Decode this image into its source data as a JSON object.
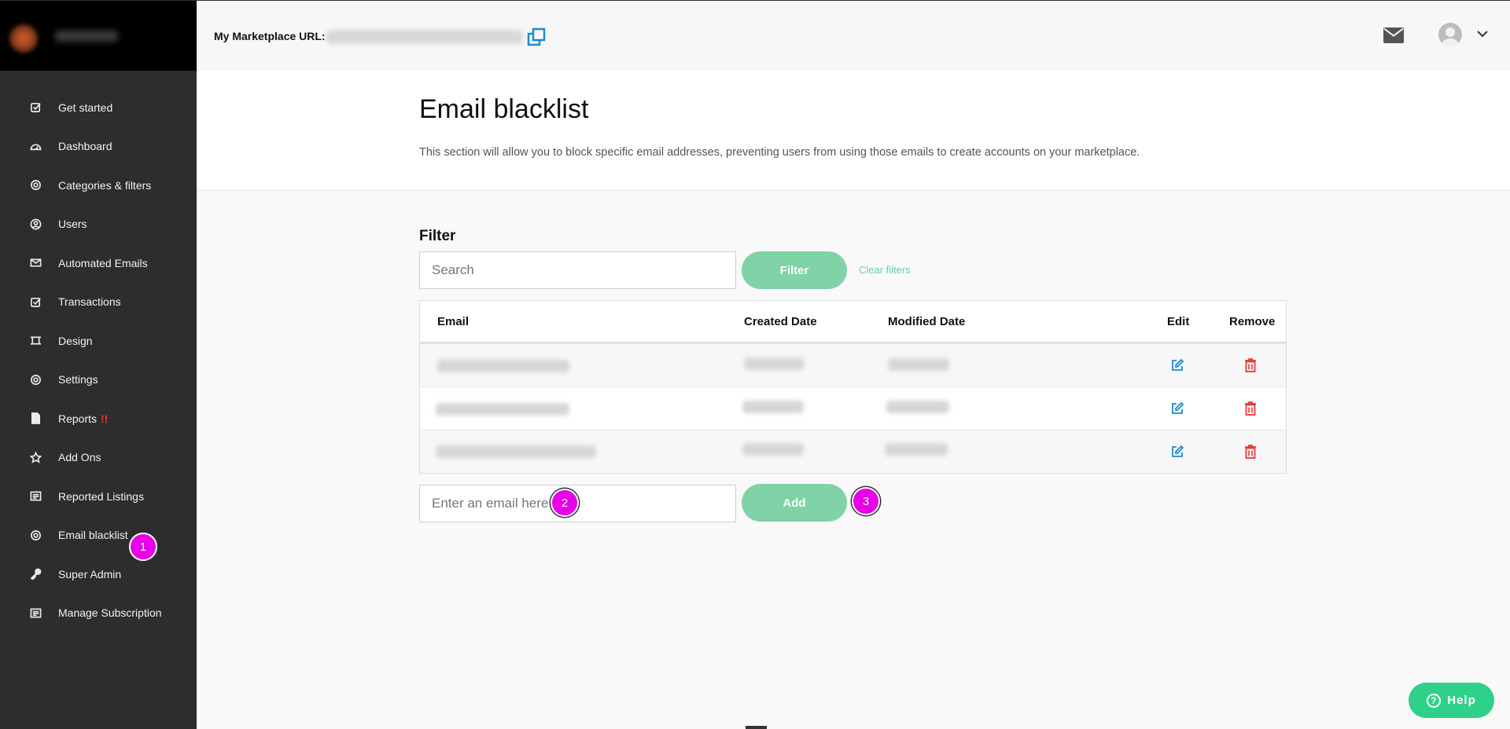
{
  "topbar": {
    "url_label": "My Marketplace URL:"
  },
  "sidebar": {
    "items": [
      {
        "label": "Get started",
        "icon": "check-square-icon"
      },
      {
        "label": "Dashboard",
        "icon": "gauge-icon"
      },
      {
        "label": "Categories & filters",
        "icon": "target-icon"
      },
      {
        "label": "Users",
        "icon": "user-circle-icon"
      },
      {
        "label": "Automated Emails",
        "icon": "envelope-icon"
      },
      {
        "label": "Transactions",
        "icon": "check-square-icon"
      },
      {
        "label": "Design",
        "icon": "design-frame-icon"
      },
      {
        "label": "Settings",
        "icon": "gear-icon"
      },
      {
        "label": "Reports",
        "icon": "file-icon",
        "badge": "!!"
      },
      {
        "label": "Add Ons",
        "icon": "star-icon"
      },
      {
        "label": "Reported Listings",
        "icon": "list-icon"
      },
      {
        "label": "Email blacklist",
        "icon": "target-icon"
      },
      {
        "label": "Super Admin",
        "icon": "key-icon"
      },
      {
        "label": "Manage Subscription",
        "icon": "list-icon"
      }
    ]
  },
  "page": {
    "title": "Email blacklist",
    "description": "This section will allow you to block specific email addresses, preventing users from using those emails to create accounts on your marketplace."
  },
  "filter": {
    "title": "Filter",
    "search_placeholder": "Search",
    "filter_button": "Filter",
    "clear_link": "Clear filters"
  },
  "table": {
    "headers": {
      "email": "Email",
      "created": "Created Date",
      "modified": "Modified Date",
      "edit": "Edit",
      "remove": "Remove"
    }
  },
  "add_form": {
    "email_placeholder": "Enter an email here",
    "add_button": "Add"
  },
  "markers": [
    "1",
    "2",
    "3"
  ],
  "help": {
    "label": "Help",
    "icon_glyph": "?"
  },
  "colors": {
    "accent_green": "#7fd3a6",
    "help_green": "#2fd18a",
    "edit_blue": "#1a8ad1",
    "remove_red": "#e53935",
    "marker_magenta": "#e800e8",
    "sidebar_bg": "#2d2d2d"
  }
}
